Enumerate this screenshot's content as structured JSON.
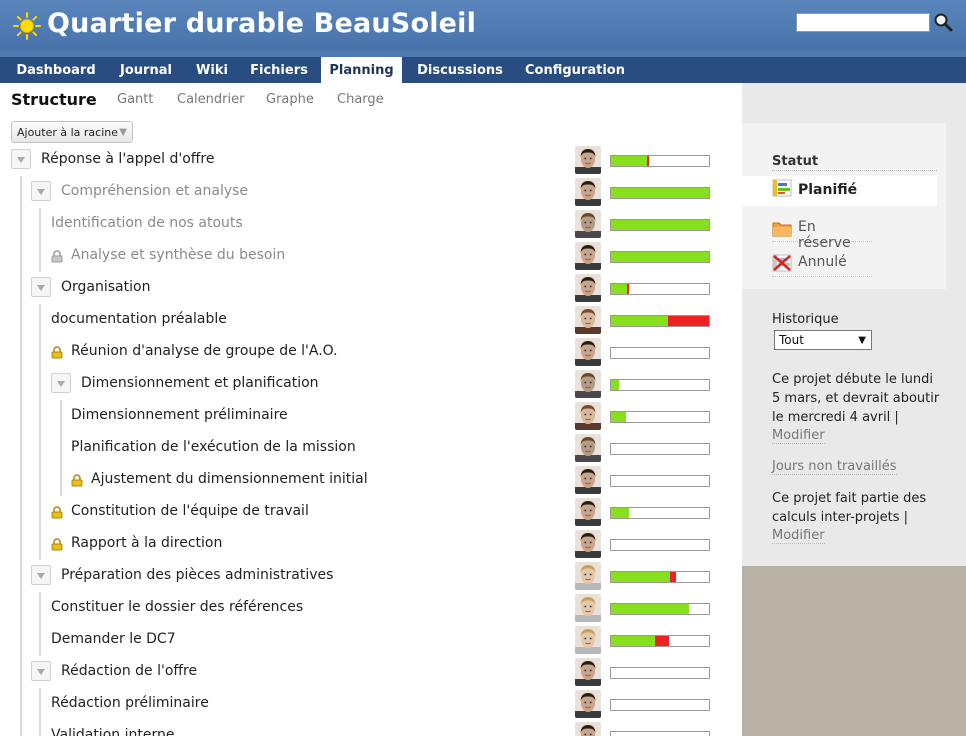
{
  "app": {
    "title": "Quartier durable BeauSoleil"
  },
  "search": {
    "value": ""
  },
  "tabs": [
    {
      "label": "Dashboard",
      "active": false
    },
    {
      "label": "Journal",
      "active": false
    },
    {
      "label": "Wiki",
      "active": false
    },
    {
      "label": "Fichiers",
      "active": false
    },
    {
      "label": "Planning",
      "active": true
    },
    {
      "label": "Discussions",
      "active": false
    },
    {
      "label": "Configuration",
      "active": false
    }
  ],
  "subtabs": [
    {
      "label": "Structure",
      "active": true
    },
    {
      "label": "Gantt",
      "active": false
    },
    {
      "label": "Calendrier",
      "active": false
    },
    {
      "label": "Graphe",
      "active": false
    },
    {
      "label": "Charge",
      "active": false
    }
  ],
  "toolbar": {
    "add_root_label": "Ajouter à la racine"
  },
  "tasks": [
    {
      "label": "Réponse à l'appel d'offre",
      "level": 0,
      "toggle": true,
      "lock": "",
      "grey": false,
      "avatar": "man",
      "done": 0.37,
      "late": 0.02
    },
    {
      "label": "Compréhension et analyse",
      "level": 1,
      "toggle": true,
      "lock": "",
      "grey": true,
      "avatar": "man",
      "done": 1.0,
      "late": 0
    },
    {
      "label": "Identification de nos atouts",
      "level": 1,
      "toggle": false,
      "lock": "",
      "grey": true,
      "avatar": "man2",
      "done": 1.0,
      "late": 0
    },
    {
      "label": "Analyse et synthèse du besoin",
      "level": 1,
      "toggle": false,
      "lock": "grey",
      "grey": true,
      "avatar": "man",
      "done": 1.0,
      "late": 0
    },
    {
      "label": "Organisation",
      "level": 1,
      "toggle": true,
      "lock": "",
      "grey": false,
      "avatar": "man",
      "done": 0.16,
      "late": 0.02
    },
    {
      "label": "documentation préalable",
      "level": 1,
      "toggle": false,
      "lock": "",
      "grey": false,
      "avatar": "woman",
      "done": 0.58,
      "late": 0.42
    },
    {
      "label": "Réunion d'analyse de groupe de l'A.O.",
      "level": 1,
      "toggle": false,
      "lock": "gold",
      "grey": false,
      "avatar": "man",
      "done": 0,
      "late": 0
    },
    {
      "label": "Dimensionnement et planification",
      "level": 2,
      "toggle": true,
      "lock": "",
      "grey": false,
      "avatar": "man2",
      "done": 0.08,
      "late": 0
    },
    {
      "label": "Dimensionnement préliminaire",
      "level": 2,
      "toggle": false,
      "lock": "",
      "grey": false,
      "avatar": "woman",
      "done": 0.15,
      "late": 0
    },
    {
      "label": "Planification de l'exécution de la mission",
      "level": 2,
      "toggle": false,
      "lock": "",
      "grey": false,
      "avatar": "man2",
      "done": 0,
      "late": 0
    },
    {
      "label": "Ajustement du dimensionnement initial",
      "level": 2,
      "toggle": false,
      "lock": "gold",
      "grey": false,
      "avatar": "man",
      "done": 0,
      "late": 0
    },
    {
      "label": "Constitution de l'équipe de travail",
      "level": 1,
      "toggle": false,
      "lock": "gold",
      "grey": false,
      "avatar": "man",
      "done": 0.18,
      "late": 0
    },
    {
      "label": "Rapport à la direction",
      "level": 1,
      "toggle": false,
      "lock": "gold",
      "grey": false,
      "avatar": "man",
      "done": 0,
      "late": 0
    },
    {
      "label": "Préparation des pièces administratives",
      "level": 1,
      "toggle": true,
      "lock": "",
      "grey": false,
      "avatar": "blond",
      "done": 0.6,
      "late": 0.06
    },
    {
      "label": "Constituer le dossier des références",
      "level": 1,
      "toggle": false,
      "lock": "",
      "grey": false,
      "avatar": "blond",
      "done": 0.8,
      "late": 0
    },
    {
      "label": "Demander le DC7",
      "level": 1,
      "toggle": false,
      "lock": "",
      "grey": false,
      "avatar": "blond",
      "done": 0.45,
      "late": 0.14
    },
    {
      "label": "Rédaction de l'offre",
      "level": 1,
      "toggle": true,
      "lock": "",
      "grey": false,
      "avatar": "man",
      "done": 0,
      "late": 0
    },
    {
      "label": "Rédaction préliminaire",
      "level": 1,
      "toggle": false,
      "lock": "",
      "grey": false,
      "avatar": "man",
      "done": 0,
      "late": 0
    },
    {
      "label": "Validation interne",
      "level": 1,
      "toggle": false,
      "lock": "",
      "grey": false,
      "avatar": "man",
      "done": 0,
      "late": 0
    }
  ],
  "sidebar": {
    "status_heading": "Statut",
    "statuses": [
      {
        "label": "Planifié",
        "icon": "planned-icon",
        "active": true
      },
      {
        "label": "En réserve",
        "icon": "folder-icon",
        "active": false
      },
      {
        "label": "Annulé",
        "icon": "cancelled-icon",
        "active": false
      }
    ],
    "history_label": "Historique",
    "history_value": "Tout",
    "dates_line1": "Ce projet débute le lundi",
    "dates_line2": "5 mars, et devrait aboutir",
    "dates_line3": "le mercredi 4 avril |",
    "modify_label": "Modifier",
    "nonworking_label": "Jours non travaillés",
    "cross_line1": "Ce projet fait partie des",
    "cross_line2": "calculs inter-projets |",
    "modify2_label": "Modifier"
  },
  "colors": {
    "header": "#4f7ab1",
    "tabbar": "#294d80",
    "progress_done": "#86e01e",
    "progress_late": "#ee2222"
  }
}
